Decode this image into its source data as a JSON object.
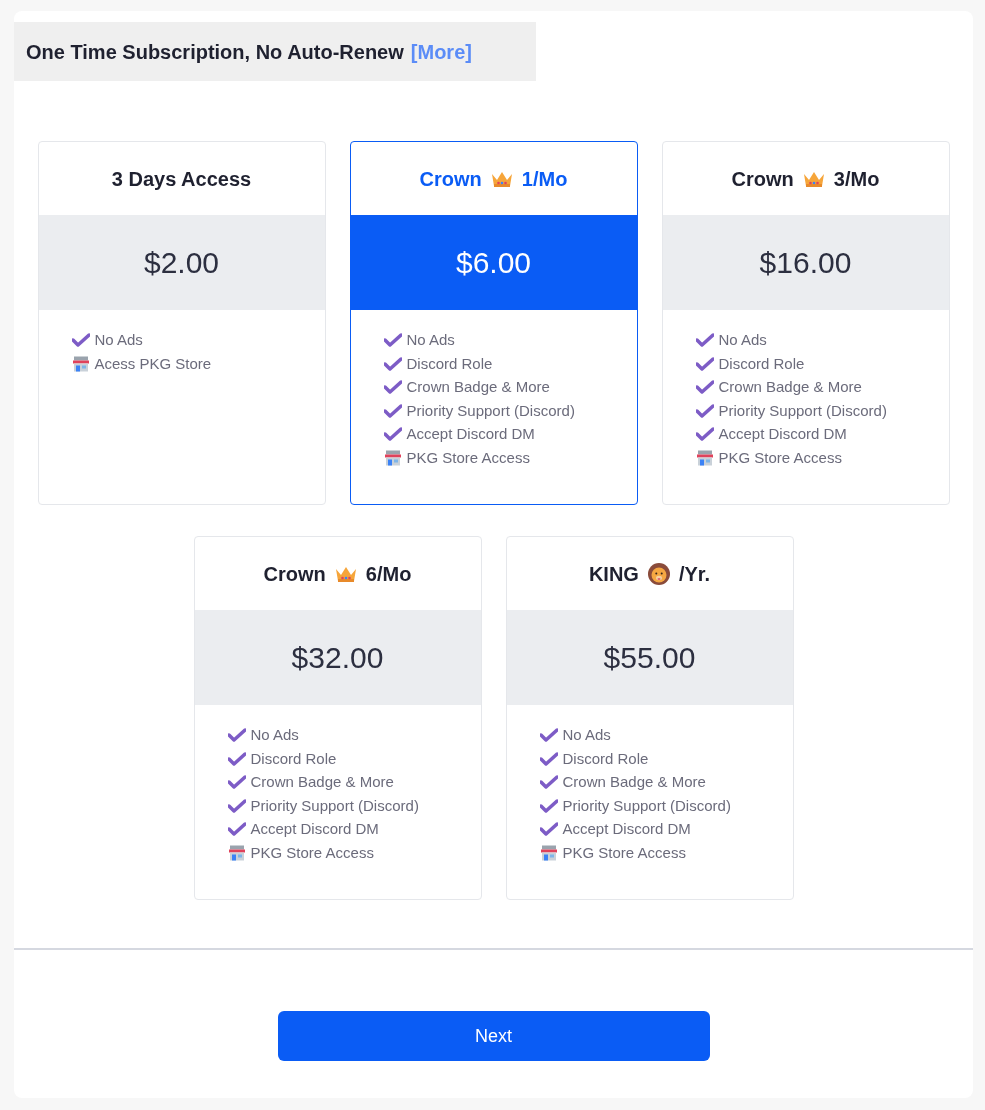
{
  "header": {
    "title": "One Time Subscription, No Auto-Renew",
    "more_link": "[More]"
  },
  "plans": [
    {
      "kind": "plain",
      "name": "3 Days Access",
      "price": "$2.00",
      "selected": false,
      "features": [
        {
          "kind": "check",
          "text": "No Ads"
        },
        {
          "kind": "store",
          "text": "Acess PKG Store"
        }
      ]
    },
    {
      "kind": "crown",
      "name": "Crown",
      "suffix": "1/Mo",
      "price": "$6.00",
      "selected": true,
      "features": [
        {
          "kind": "check",
          "text": "No Ads"
        },
        {
          "kind": "check",
          "text": "Discord Role"
        },
        {
          "kind": "check",
          "text": "Crown Badge & More"
        },
        {
          "kind": "check",
          "text": "Priority Support (Discord)"
        },
        {
          "kind": "check",
          "text": "Accept Discord DM"
        },
        {
          "kind": "store",
          "text": "PKG Store Access"
        }
      ]
    },
    {
      "kind": "crown",
      "name": "Crown",
      "suffix": "3/Mo",
      "price": "$16.00",
      "selected": false,
      "features": [
        {
          "kind": "check",
          "text": "No Ads"
        },
        {
          "kind": "check",
          "text": "Discord Role"
        },
        {
          "kind": "check",
          "text": "Crown Badge & More"
        },
        {
          "kind": "check",
          "text": "Priority Support (Discord)"
        },
        {
          "kind": "check",
          "text": "Accept Discord DM"
        },
        {
          "kind": "store",
          "text": "PKG Store Access"
        }
      ]
    },
    {
      "kind": "crown",
      "name": "Crown",
      "suffix": "6/Mo",
      "price": "$32.00",
      "selected": false,
      "features": [
        {
          "kind": "check",
          "text": "No Ads"
        },
        {
          "kind": "check",
          "text": "Discord Role"
        },
        {
          "kind": "check",
          "text": "Crown Badge & More"
        },
        {
          "kind": "check",
          "text": "Priority Support (Discord)"
        },
        {
          "kind": "check",
          "text": "Accept Discord DM"
        },
        {
          "kind": "store",
          "text": "PKG Store Access"
        }
      ]
    },
    {
      "kind": "lion",
      "name": "KING",
      "suffix": "/Yr.",
      "price": "$55.00",
      "selected": false,
      "features": [
        {
          "kind": "check",
          "text": "No Ads"
        },
        {
          "kind": "check",
          "text": "Discord Role"
        },
        {
          "kind": "check",
          "text": "Crown Badge & More"
        },
        {
          "kind": "check",
          "text": "Priority Support (Discord)"
        },
        {
          "kind": "check",
          "text": "Accept Discord DM"
        },
        {
          "kind": "store",
          "text": "PKG Store Access"
        }
      ]
    }
  ],
  "next_button": "Next"
}
